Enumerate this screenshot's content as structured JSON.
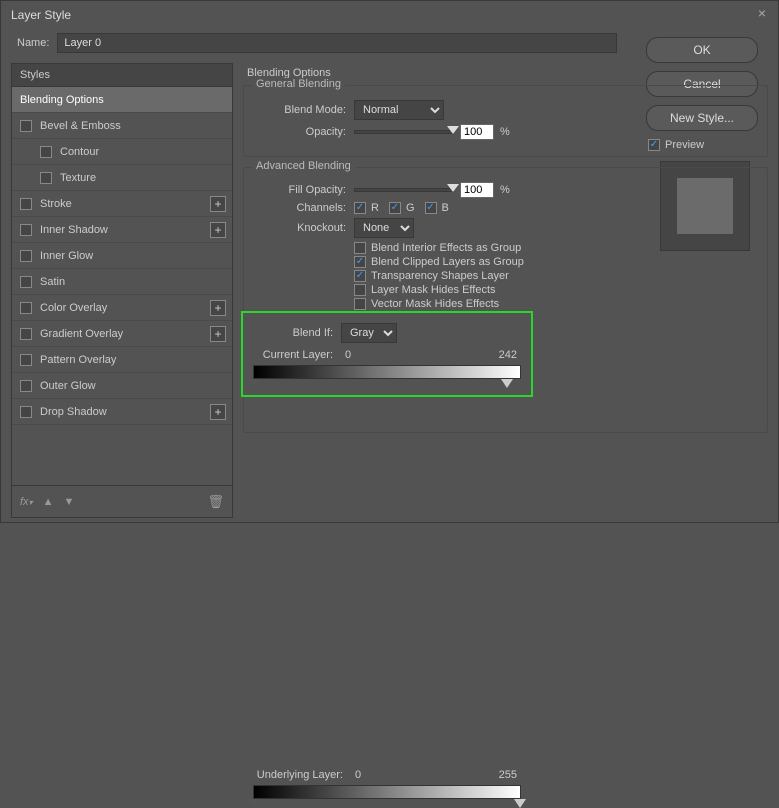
{
  "title": "Layer Style",
  "name_label": "Name:",
  "name_value": "Layer 0",
  "styles": {
    "header": "Styles",
    "items": [
      {
        "label": "Blending Options",
        "selected": true,
        "check": false,
        "plus": false
      },
      {
        "label": "Bevel & Emboss",
        "check": true,
        "plus": false
      },
      {
        "label": "Contour",
        "check": true,
        "plus": false,
        "sub": true
      },
      {
        "label": "Texture",
        "check": true,
        "plus": false,
        "sub": true
      },
      {
        "label": "Stroke",
        "check": true,
        "plus": true
      },
      {
        "label": "Inner Shadow",
        "check": true,
        "plus": true
      },
      {
        "label": "Inner Glow",
        "check": true,
        "plus": false
      },
      {
        "label": "Satin",
        "check": true,
        "plus": false
      },
      {
        "label": "Color Overlay",
        "check": true,
        "plus": true
      },
      {
        "label": "Gradient Overlay",
        "check": true,
        "plus": true
      },
      {
        "label": "Pattern Overlay",
        "check": true,
        "plus": false
      },
      {
        "label": "Outer Glow",
        "check": true,
        "plus": false
      },
      {
        "label": "Drop Shadow",
        "check": true,
        "plus": true
      }
    ]
  },
  "mid": {
    "heading": "Blending Options",
    "general": {
      "label": "General Blending",
      "blend_mode_label": "Blend Mode:",
      "blend_mode_value": "Normal",
      "opacity_label": "Opacity:",
      "opacity_value": "100",
      "opacity_unit": "%"
    },
    "advanced": {
      "label": "Advanced Blending",
      "fill_label": "Fill Opacity:",
      "fill_value": "100",
      "fill_unit": "%",
      "channels_label": "Channels:",
      "ch_r": "R",
      "ch_g": "G",
      "ch_b": "B",
      "knockout_label": "Knockout:",
      "knockout_value": "None",
      "opt1": "Blend Interior Effects as Group",
      "opt2": "Blend Clipped Layers as Group",
      "opt3": "Transparency Shapes Layer",
      "opt4": "Layer Mask Hides Effects",
      "opt5": "Vector Mask Hides Effects"
    },
    "blendif": {
      "label": "Blend If:",
      "value": "Gray",
      "current_label": "Current Layer:",
      "current_low": "0",
      "current_high": "242",
      "underlying_label": "Underlying Layer:",
      "under_low": "0",
      "under_high": "255"
    }
  },
  "right": {
    "ok": "OK",
    "cancel": "Cancel",
    "new_style": "New Style...",
    "preview": "Preview"
  }
}
